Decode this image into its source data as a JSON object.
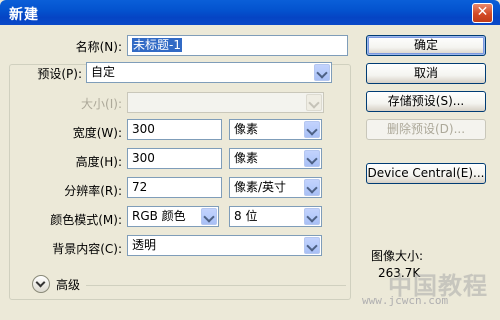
{
  "window": {
    "title": "新建",
    "close_glyph": "✕"
  },
  "form": {
    "name": {
      "label": "名称(N):",
      "value": "未标题-1"
    },
    "preset": {
      "label": "预设(P):",
      "value": "自定"
    },
    "size": {
      "label": "大小(I):",
      "value": ""
    },
    "width": {
      "label": "宽度(W):",
      "value": "300",
      "unit": "像素"
    },
    "height": {
      "label": "高度(H):",
      "value": "300",
      "unit": "像素"
    },
    "resolution": {
      "label": "分辨率(R):",
      "value": "72",
      "unit": "像素/英寸"
    },
    "color_mode": {
      "label": "颜色模式(M):",
      "value": "RGB 颜色",
      "bits": "8 位"
    },
    "background": {
      "label": "背景内容(C):",
      "value": "透明"
    },
    "advanced": {
      "label": "高级"
    }
  },
  "buttons": {
    "ok": "确定",
    "cancel": "取消",
    "save_preset": "存储预设(S)...",
    "delete_preset": "删除预设(D)...",
    "device_central": "Device Central(E)..."
  },
  "image_size": {
    "label": "图像大小:",
    "value": "263.7K"
  },
  "watermark": {
    "text": "中国教程",
    "url": "www.jcwcn.com"
  }
}
